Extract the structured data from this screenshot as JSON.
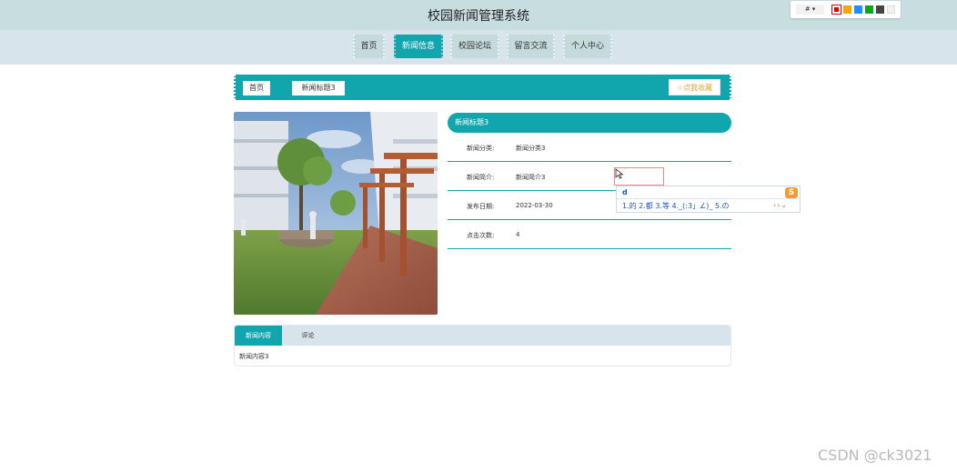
{
  "header": {
    "title": "校园新闻管理系统",
    "lang_label": "# ▾",
    "theme_colors": [
      "#e00000",
      "#f5a700",
      "#1e8fff",
      "#12a31e",
      "#444444",
      "#f2f2f2"
    ]
  },
  "nav": {
    "items": [
      {
        "label": "首页"
      },
      {
        "label": "新闻信息"
      },
      {
        "label": "校园论坛"
      },
      {
        "label": "留言交流"
      },
      {
        "label": "个人中心"
      }
    ]
  },
  "breadcrumb": {
    "home": "首页",
    "current": "新闻标题3",
    "favorite": "☆点我收藏"
  },
  "detail": {
    "title": "新闻标题3",
    "rows": [
      {
        "label": "新闻分类:",
        "value": "新闻分类3"
      },
      {
        "label": "新闻简介:",
        "value": "新闻简介3"
      },
      {
        "label": "发布日期:",
        "value": "2022-03-30"
      },
      {
        "label": "点击次数:",
        "value": "4"
      }
    ]
  },
  "ime": {
    "input": "d",
    "candidates": "1.的  2.都  3.等  4._(:3」∠)_  5.の"
  },
  "tabs": {
    "items": [
      {
        "label": "新闻内容"
      },
      {
        "label": "评论"
      }
    ],
    "content": "新闻内容3"
  },
  "watermark": "CSDN @ck3021",
  "colors": {
    "accent": "#11a6ad",
    "header_bg": "#c7dde0",
    "nav_bg": "#d8e4ec"
  }
}
